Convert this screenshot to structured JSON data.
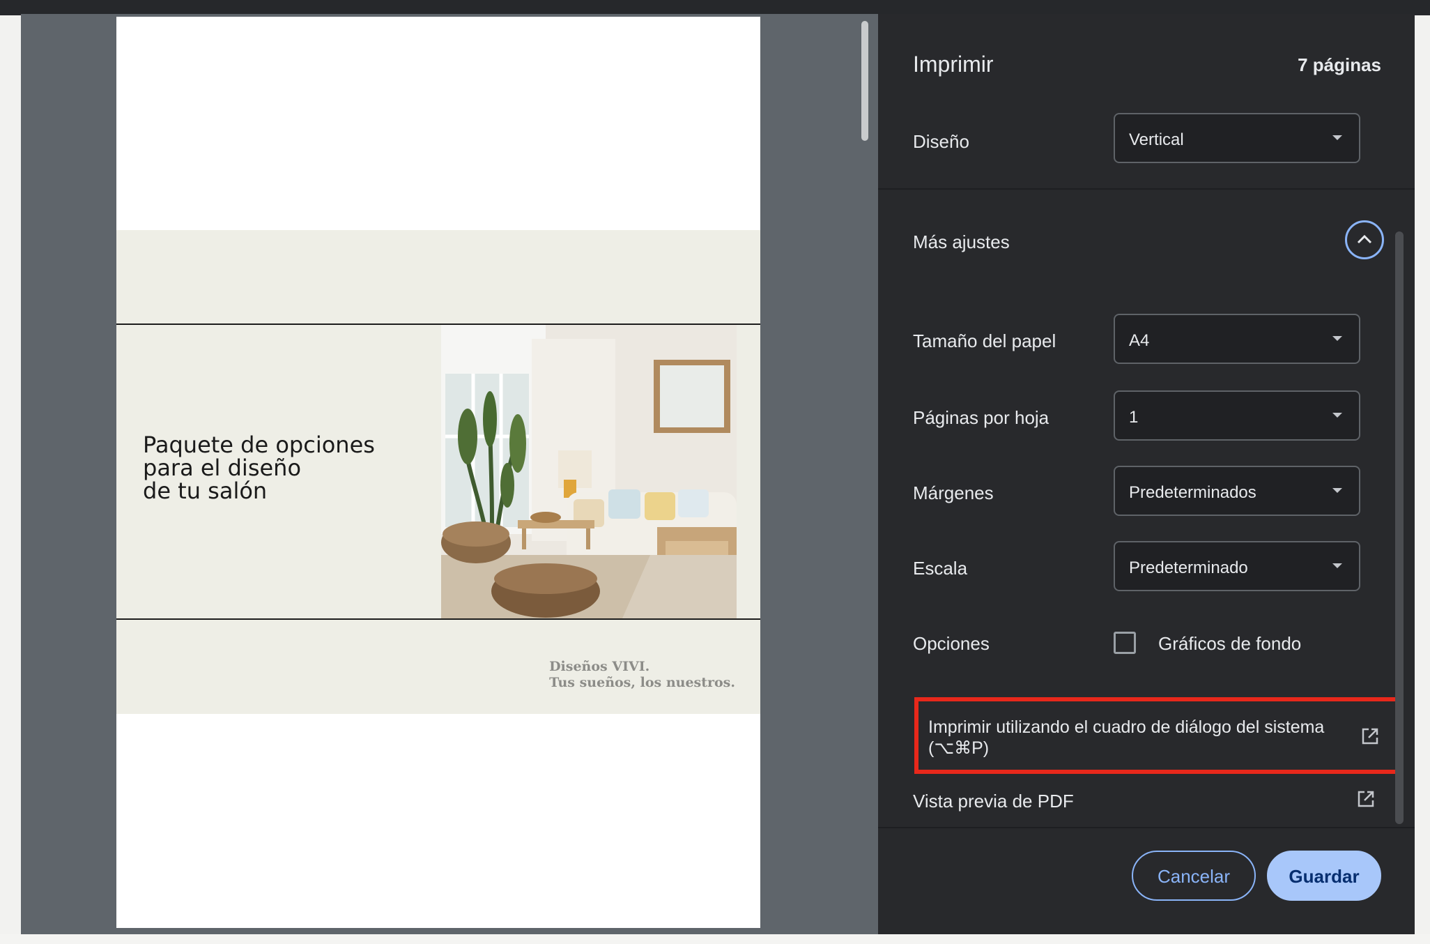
{
  "preview": {
    "document_title_lines": [
      "Paquete de opciones",
      "para el diseño",
      "de tu salón"
    ],
    "tagline_lines": [
      "Diseños VIVI.",
      "Tus sueños, los nuestros."
    ],
    "photo_description_icon": "living-room-photo"
  },
  "panel": {
    "title": "Imprimir",
    "page_count": "7 páginas",
    "layout": {
      "label": "Diseño",
      "value": "Vertical"
    },
    "more_settings": {
      "label": "Más ajustes",
      "icon": "chevron-up-icon"
    },
    "paper_size": {
      "label": "Tamaño del papel",
      "value": "A4"
    },
    "pages_per_sheet": {
      "label": "Páginas por hoja",
      "value": "1"
    },
    "margins": {
      "label": "Márgenes",
      "value": "Predeterminados"
    },
    "scale": {
      "label": "Escala",
      "value": "Predeterminado"
    },
    "options": {
      "label": "Opciones",
      "checkbox_label": "Gráficos de fondo",
      "checked": false
    },
    "system_dialog": {
      "label": "Imprimir utilizando el cuadro de diálogo del sistema (⌥⌘P)",
      "icon": "open-external-icon"
    },
    "pdf_preview": {
      "label": "Vista previa de PDF",
      "icon": "open-external-icon"
    },
    "buttons": {
      "cancel": "Cancelar",
      "save": "Guardar"
    }
  },
  "colors": {
    "accent": "#8ab4f8",
    "save_button": "#a8c7fa",
    "highlight_box": "#e8281b",
    "panel_bg": "#28292c",
    "preview_bg": "#5f656b",
    "page_band": "#eeeee6"
  }
}
